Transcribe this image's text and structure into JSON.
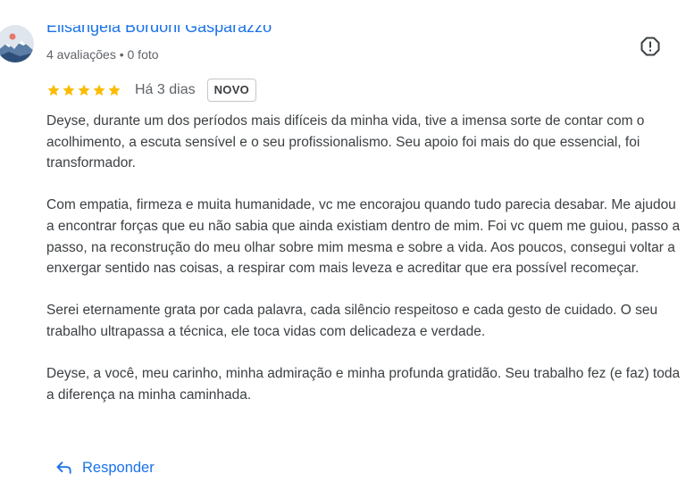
{
  "reviewer": {
    "name": "Elisangela Bordoni Gasparazzo",
    "meta": "4 avaliações • 0 foto",
    "avatar_icon": "mountain-avatar-icon"
  },
  "report": {
    "icon": "report-icon"
  },
  "rating": {
    "stars": 5,
    "max_stars": 5,
    "star_color": "#fbbc04",
    "date": "Há 3 dias",
    "badge": "NOVO"
  },
  "review": {
    "paragraphs": [
      "Deyse, durante um dos períodos mais difíceis da minha vida, tive a imensa sorte de contar com o acolhimento, a escuta sensível e o seu profissionalismo. Seu apoio foi mais do que essencial, foi transformador.",
      "Com empatia, firmeza e muita humanidade, vc me encorajou quando tudo parecia desabar. Me ajudou a encontrar forças que eu não sabia que ainda existiam dentro de mim. Foi vc quem me guiou, passo a passo, na reconstrução do meu olhar sobre mim mesma e sobre a vida. Aos poucos, consegui voltar a enxergar sentido nas coisas, a respirar com mais leveza e acreditar que era possível recomeçar.",
      "Serei eternamente grata por cada palavra, cada silêncio respeitoso e cada gesto de cuidado. O seu trabalho ultrapassa a técnica, ele toca vidas com delicadeza e verdade.",
      "Deyse, a você, meu carinho, minha admiração e minha profunda gratidão. Seu trabalho fez (e faz) toda a diferença na minha caminhada."
    ]
  },
  "actions": {
    "reply_label": "Responder",
    "reply_icon": "reply-icon",
    "accent_color": "#1a73e8"
  }
}
